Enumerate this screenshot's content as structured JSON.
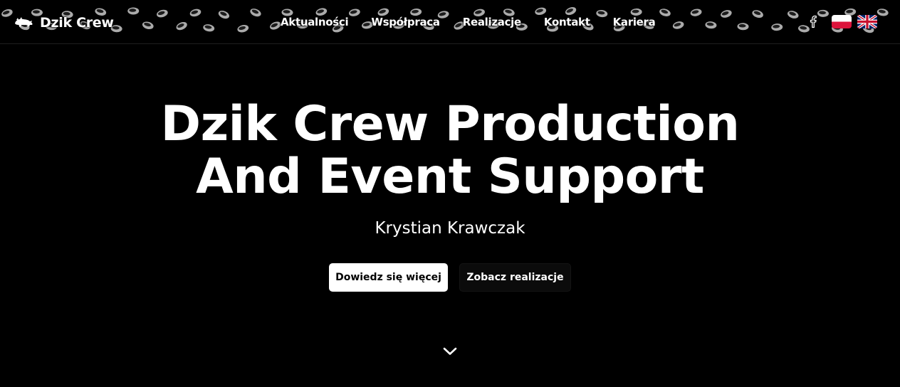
{
  "header": {
    "brand": {
      "logo_icon": "boar-logo-icon",
      "name": "Dzik Crew"
    },
    "nav": [
      {
        "label": "Aktualności"
      },
      {
        "label": "Współpraca"
      },
      {
        "label": "Realizacje"
      },
      {
        "label": "Kontakt"
      },
      {
        "label": "Kariera"
      }
    ],
    "social": {
      "facebook_icon": "facebook-icon"
    },
    "languages": [
      {
        "icon": "flag-pl-icon",
        "colors": [
          "#ffffff",
          "#dc143c"
        ]
      },
      {
        "icon": "flag-uk-icon",
        "colors": [
          "#012169",
          "#ffffff",
          "#c8102e"
        ]
      }
    ]
  },
  "hero": {
    "title_line1": "Dzik Crew Production",
    "title_line2": "And Event Support",
    "subtitle": "Krystian Krawczak",
    "primary_button": "Dowiedz się więcej",
    "secondary_button": "Zobacz realizacje",
    "scroll_icon": "chevron-down-icon"
  },
  "colors": {
    "background": "#000000",
    "text": "#ffffff",
    "primary_button_bg": "#ffffff",
    "primary_button_text": "#000000",
    "secondary_button_bg": "#0b0b0b"
  }
}
